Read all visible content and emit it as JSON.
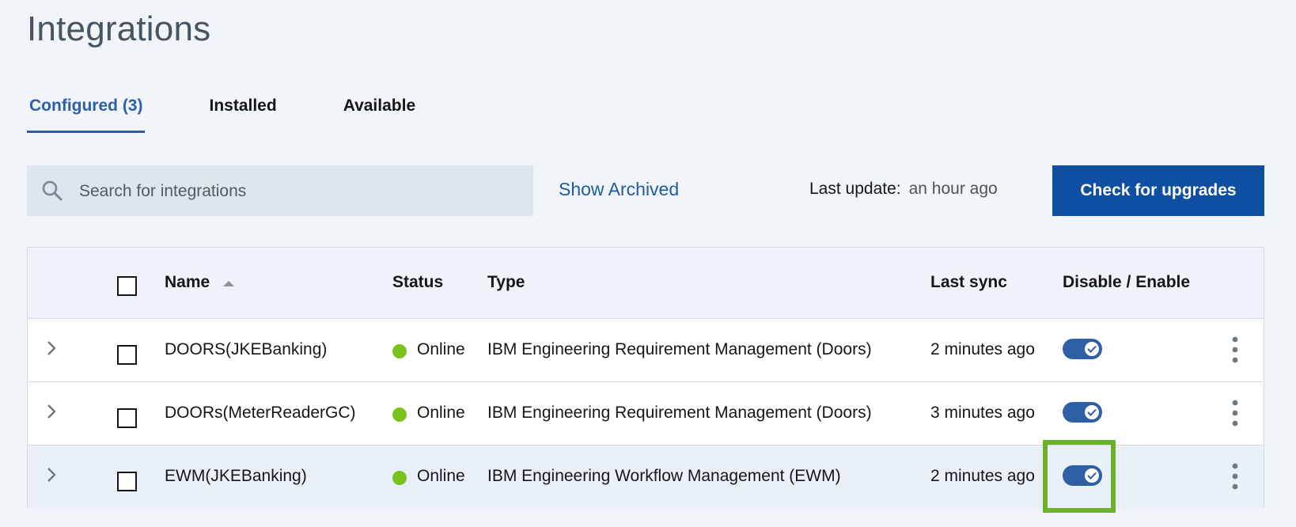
{
  "page": {
    "title": "Integrations"
  },
  "tabs": [
    {
      "label": "Configured (3)",
      "active": true
    },
    {
      "label": "Installed",
      "active": false
    },
    {
      "label": "Available",
      "active": false
    }
  ],
  "toolbar": {
    "search_placeholder": "Search for integrations",
    "show_archived": "Show Archived",
    "last_update_label": "Last update:",
    "last_update_value": "an hour ago",
    "upgrade_button": "Check for upgrades"
  },
  "table": {
    "headers": {
      "name": "Name",
      "status": "Status",
      "type": "Type",
      "last_sync": "Last sync",
      "toggle": "Disable / Enable"
    },
    "rows": [
      {
        "name": "DOORS(JKEBanking)",
        "status": "Online",
        "type": "IBM Engineering Requirement Management (Doors)",
        "last_sync": "2 minutes ago",
        "enabled": true
      },
      {
        "name": "DOORs(MeterReaderGC)",
        "status": "Online",
        "type": "IBM Engineering Requirement Management (Doors)",
        "last_sync": "3 minutes ago",
        "enabled": true
      },
      {
        "name": "EWM(JKEBanking)",
        "status": "Online",
        "type": "IBM Engineering Workflow Management (EWM)",
        "last_sync": "2 minutes ago",
        "enabled": true
      }
    ]
  },
  "colors": {
    "accent": "#2c5fa5",
    "primary_button": "#0e4fa1",
    "status_online": "#79c41c",
    "highlight": "#6cb02b"
  }
}
